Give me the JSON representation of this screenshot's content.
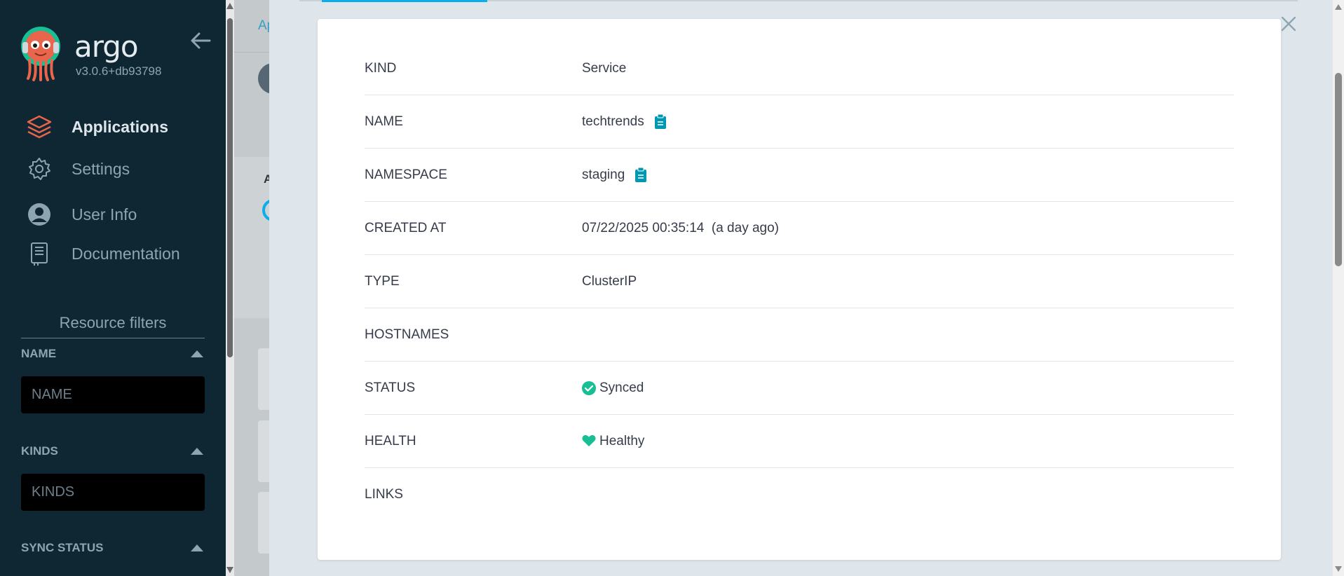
{
  "sidebar": {
    "brand": "argo",
    "version": "v3.0.6+db93798",
    "nav": [
      {
        "label": "Applications",
        "icon": "layers-icon",
        "active": true
      },
      {
        "label": "Settings",
        "icon": "gear-icon",
        "active": false
      },
      {
        "label": "User Info",
        "icon": "user-icon",
        "active": false
      },
      {
        "label": "Documentation",
        "icon": "book-icon",
        "active": false
      }
    ],
    "filters": {
      "title": "Resource filters",
      "name": {
        "label": "NAME",
        "placeholder": "NAME"
      },
      "kinds": {
        "label": "KINDS",
        "placeholder": "KINDS"
      },
      "sync_status": {
        "label": "SYNC STATUS"
      }
    }
  },
  "background": {
    "breadcrumb": "Ap",
    "heading_letter": "A"
  },
  "details": {
    "rows": [
      {
        "key": "KIND",
        "value": "Service"
      },
      {
        "key": "NAME",
        "value": "techtrends"
      },
      {
        "key": "NAMESPACE",
        "value": "staging"
      },
      {
        "key": "CREATED AT",
        "value": "07/22/2025 00:35:14  (a day ago)"
      },
      {
        "key": "TYPE",
        "value": "ClusterIP"
      },
      {
        "key": "HOSTNAMES",
        "value": ""
      },
      {
        "key": "STATUS",
        "value": "Synced"
      },
      {
        "key": "HEALTH",
        "value": "Healthy"
      },
      {
        "key": "LINKS",
        "value": ""
      }
    ]
  },
  "colors": {
    "sidebar_bg": "#0f2733",
    "accent": "#0dadea",
    "copy_icon": "#0097b2",
    "status_green": "#18be94",
    "brand_orange": "#e9654b"
  }
}
